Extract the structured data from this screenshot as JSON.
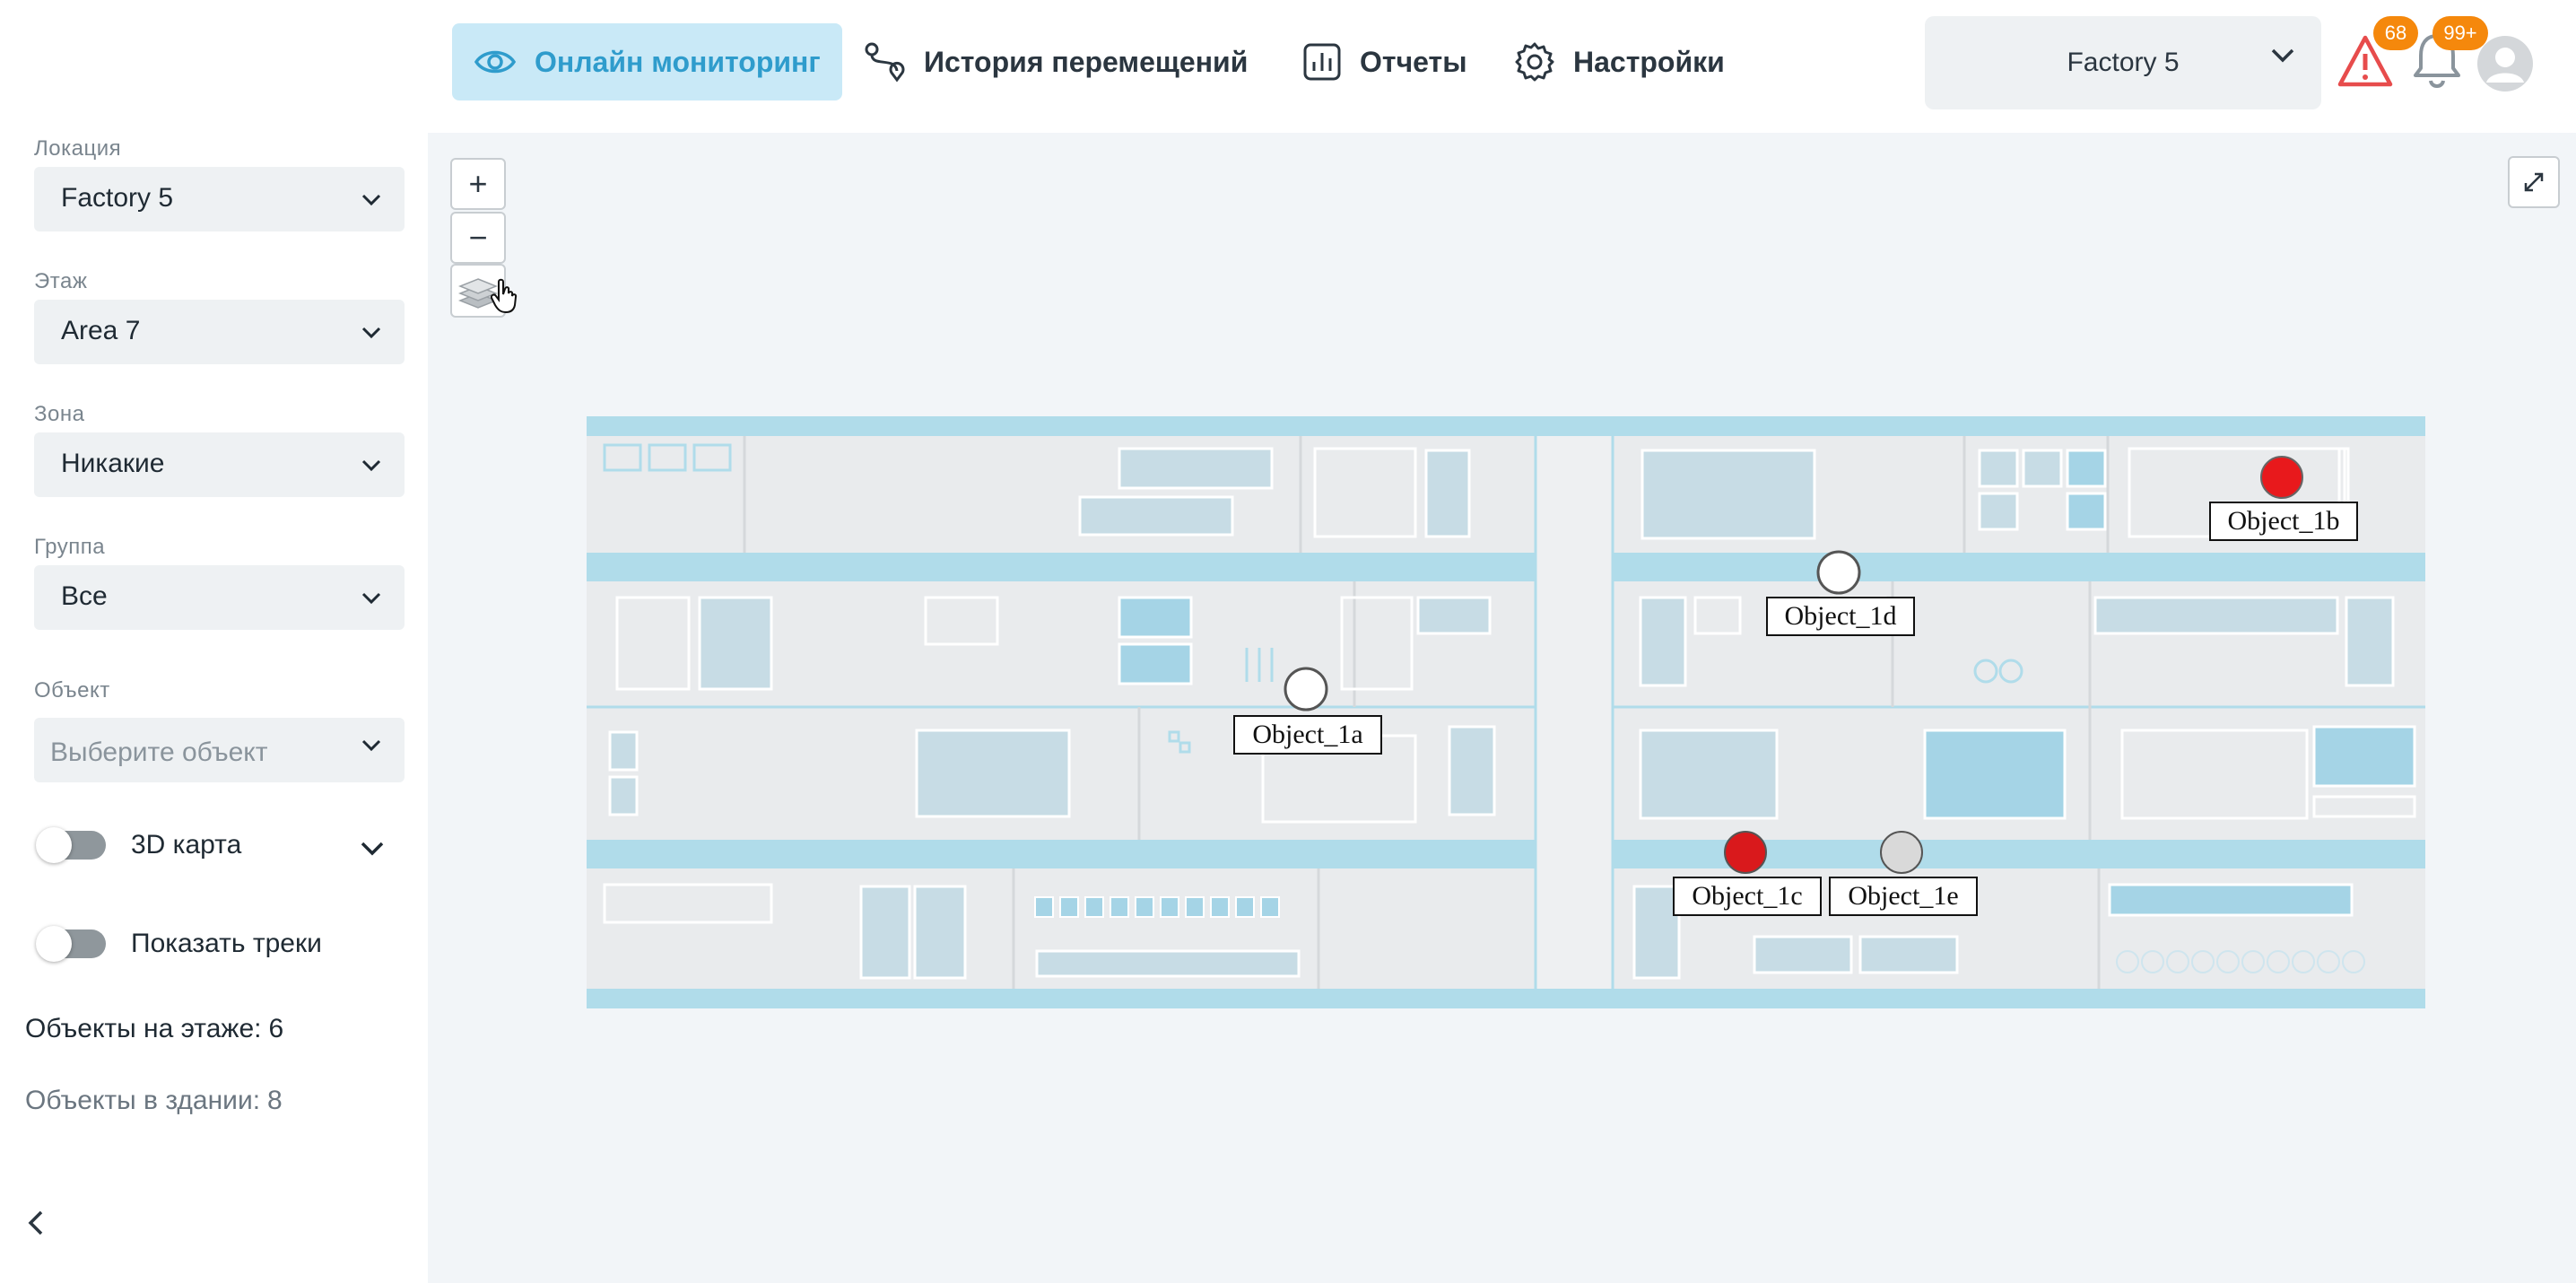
{
  "nav": {
    "items": [
      {
        "label": "Онлайн мониторинг",
        "icon": "eye-icon",
        "active": true
      },
      {
        "label": "История перемещений",
        "icon": "route-icon",
        "active": false
      },
      {
        "label": "Отчеты",
        "icon": "chart-icon",
        "active": false
      },
      {
        "label": "Настройки",
        "icon": "gear-icon",
        "active": false
      }
    ],
    "factory_select": "Factory 5",
    "alerts_count": "68",
    "notifications_count": "99+",
    "accent_color": "#2f9ccc",
    "badge_color": "#f5880c",
    "alert_color": "#e74c4c"
  },
  "sidebar": {
    "location": {
      "label": "Локация",
      "value": "Factory 5"
    },
    "floor": {
      "label": "Этаж",
      "value": "Area 7"
    },
    "zone": {
      "label": "Зона",
      "value": "Никакие"
    },
    "group": {
      "label": "Группа",
      "value": "Все"
    },
    "object": {
      "label": "Объект",
      "placeholder": "Выберите объект"
    },
    "map3d": {
      "label": "3D карта",
      "enabled": false
    },
    "tracks": {
      "label": "Показать треки",
      "enabled": false
    },
    "stats": {
      "floor_label": "Объекты на этаже:",
      "floor_value": "6",
      "building_label": "Объекты в здании:",
      "building_value": "8"
    }
  },
  "map": {
    "zoom_in": "+",
    "zoom_out": "−",
    "objects": [
      {
        "name": "Object_1a",
        "status": "white"
      },
      {
        "name": "Object_1b",
        "status": "red"
      },
      {
        "name": "Object_1c",
        "status": "red"
      },
      {
        "name": "Object_1d",
        "status": "white"
      },
      {
        "name": "Object_1e",
        "status": "gray"
      }
    ],
    "colors": {
      "red": "#e8191c",
      "white": "#ffffff",
      "gray": "#d9d9d9",
      "corridor": "#b0dcea"
    }
  }
}
